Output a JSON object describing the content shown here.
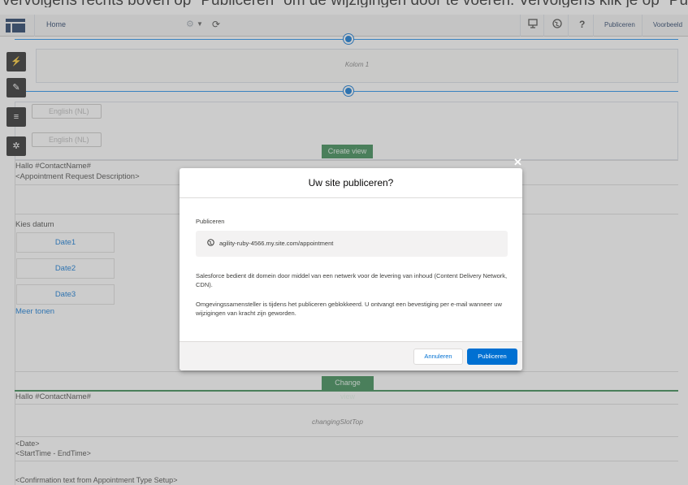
{
  "caption": {
    "text": "vervolgens rechts boven op \"Publiceren\" om de wijzigingen door te voeren. Vervolgens klik je op \"Publiceren\""
  },
  "toolbar": {
    "page_label": "Home",
    "publish_label": "Publiceren",
    "preview_label": "Voorbeeld"
  },
  "builder": {
    "column_label": "Kolom 1",
    "language_select_1": "English (NL)",
    "language_select_2": "English (NL)",
    "create_view_label": "Create view",
    "change_view_label": "Change view",
    "greeting_1": "Hallo #ContactName#",
    "request_description": "<Appointment Request Description>",
    "choose_date": "Kies datum",
    "dates": [
      "Date1",
      "Date2",
      "Date3"
    ],
    "show_more": "Meer tonen",
    "greeting_2": "Hallo #ContactName#",
    "slot_label": "changingSlotTop",
    "date_placeholder": "<Date>",
    "time_placeholder": "<StartTime - EndTime>",
    "confirmation_placeholder": "<Confirmation text from Appointment Type Setup>"
  },
  "modal": {
    "title": "Uw site publiceren?",
    "section_label": "Publiceren",
    "url": "agility-ruby-4566.my.site.com/appointment",
    "cdn_text": "Salesforce bedient dit domein door middel van een netwerk voor de levering van inhoud (Content Delivery Network, CDN).",
    "lock_text": "Omgevingssamensteller is tijdens het publiceren geblokkeerd. U ontvangt een bevestiging per e-mail wanneer uw wijzigingen van kracht zijn geworden.",
    "cancel_label": "Annuleren",
    "publish_label": "Publiceren"
  },
  "icons": {
    "app_launcher": "app-launcher-icon",
    "settings": "gear-icon",
    "refresh": "refresh-icon",
    "device": "device-icon",
    "globe": "globe-icon",
    "help": "help-icon",
    "close": "close-icon"
  },
  "colors": {
    "brand_blue": "#0070d2",
    "toolbar_navy": "#16325c",
    "view_green": "#2e844a"
  }
}
